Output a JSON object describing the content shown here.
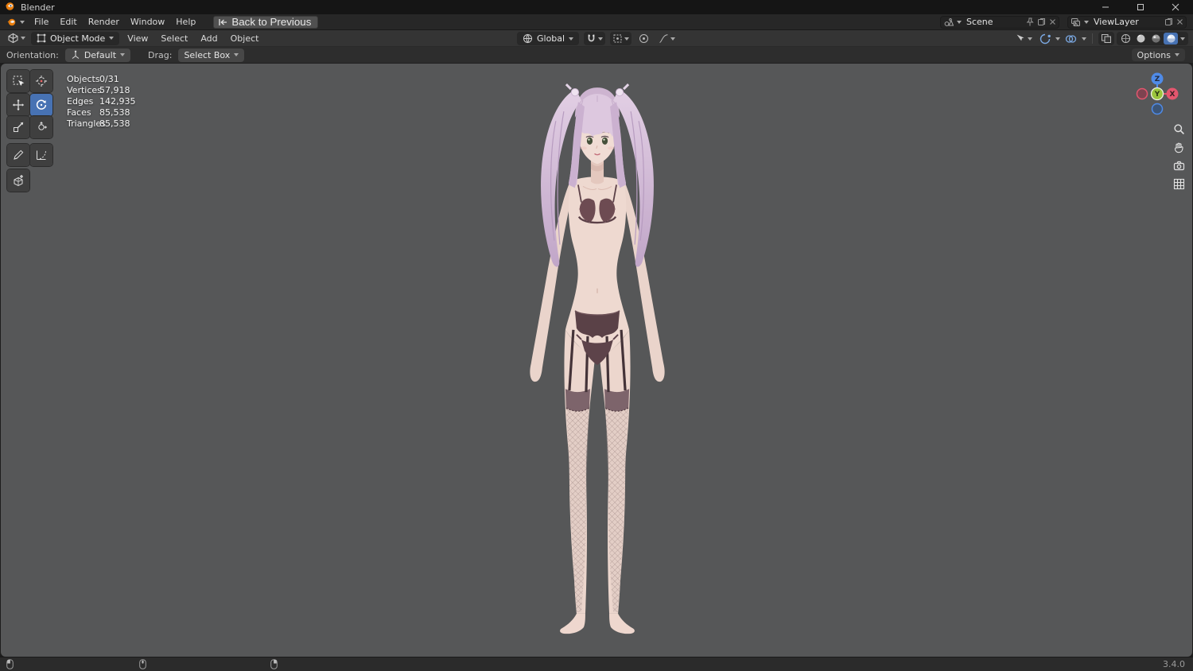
{
  "window": {
    "title": "Blender"
  },
  "topbar": {
    "menus": [
      "File",
      "Edit",
      "Render",
      "Window",
      "Help"
    ],
    "back_button": "Back to Previous",
    "scene_value": "Scene",
    "viewlayer_value": "ViewLayer"
  },
  "header": {
    "mode_value": "Object Mode",
    "menus": [
      "View",
      "Select",
      "Add",
      "Object"
    ],
    "orientation_value": "Global",
    "options_label": "Options"
  },
  "tool_settings": {
    "orientation_label": "Orientation:",
    "orientation_value": "Default",
    "drag_label": "Drag:",
    "drag_value": "Select Box"
  },
  "toolbar": {
    "tools": [
      "select-box",
      "cursor",
      "move",
      "rotate",
      "scale",
      "transform",
      "annotate",
      "measure",
      "add-cube"
    ],
    "active_tool": "rotate"
  },
  "viewport_stats": {
    "rows": [
      {
        "label": "Objects",
        "value": "0/31"
      },
      {
        "label": "Vertices",
        "value": "57,918"
      },
      {
        "label": "Edges",
        "value": "142,935"
      },
      {
        "label": "Faces",
        "value": "85,538"
      },
      {
        "label": "Triangles",
        "value": "85,538"
      }
    ]
  },
  "nav_gizmo": {
    "axis_z": "Z",
    "axis_y": "Y",
    "axis_x": "X"
  },
  "status_bar": {
    "version": "3.4.0"
  },
  "icons": {
    "blender-logo": "orange-circle-glyph",
    "back-arrow": "arrow-left-bar",
    "caret-down": "triangle-down",
    "magnet": "u-magnet",
    "magnifier": "circle-with-handle",
    "hand": "palm",
    "camera": "camera-body",
    "grid": "3x3-grid",
    "mouse": "mouse-outline"
  },
  "colors": {
    "accent": "#4772b3",
    "axis_x": "#e4566e",
    "axis_y": "#9bc53d",
    "axis_z": "#4f8be8",
    "viewport_bg": "#565758"
  }
}
